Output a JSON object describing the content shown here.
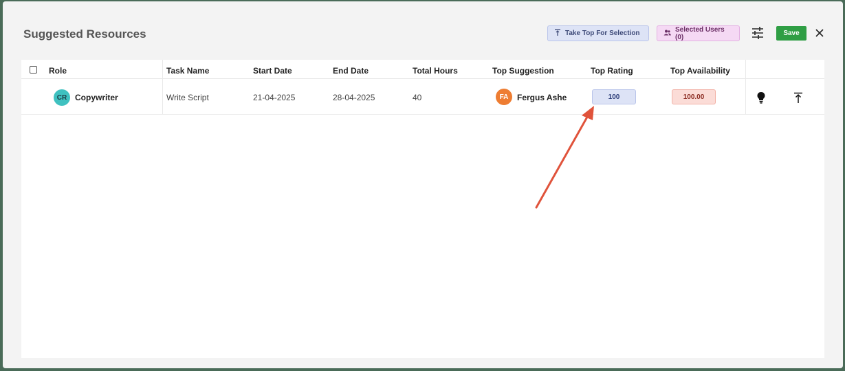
{
  "modal": {
    "title": "Suggested Resources",
    "take_top_label": "Take Top For Selection",
    "selected_users_label": "Selected Users (0)",
    "save_label": "Save"
  },
  "table": {
    "columns": [
      "Role",
      "Task Name",
      "Start Date",
      "End Date",
      "Total Hours",
      "Top Suggestion",
      "Top Rating",
      "Top Availability"
    ],
    "rows": [
      {
        "role_initials": "CR",
        "role": "Copywriter",
        "task_name": "Write Script",
        "start_date": "21-04-2025",
        "end_date": "28-04-2025",
        "total_hours": "40",
        "suggestion_initials": "FA",
        "top_suggestion": "Fergus Ashe",
        "top_rating": "100",
        "top_availability": "100.00"
      }
    ]
  },
  "icons": {
    "take_top": "align-top-icon",
    "selected_users": "users-icon",
    "filter": "sliders-icon",
    "close": "close-icon",
    "row_action_1": "lightbulb-icon",
    "row_action_2": "align-top-icon"
  },
  "colors": {
    "save": "#2f9e44",
    "rating_pill": "#dde3f6",
    "availability_pill": "#fbdcd7",
    "avatar_cr": "#3fc1c0",
    "avatar_fa": "#ee7d32",
    "annotation_arrow": "#e0533b"
  }
}
